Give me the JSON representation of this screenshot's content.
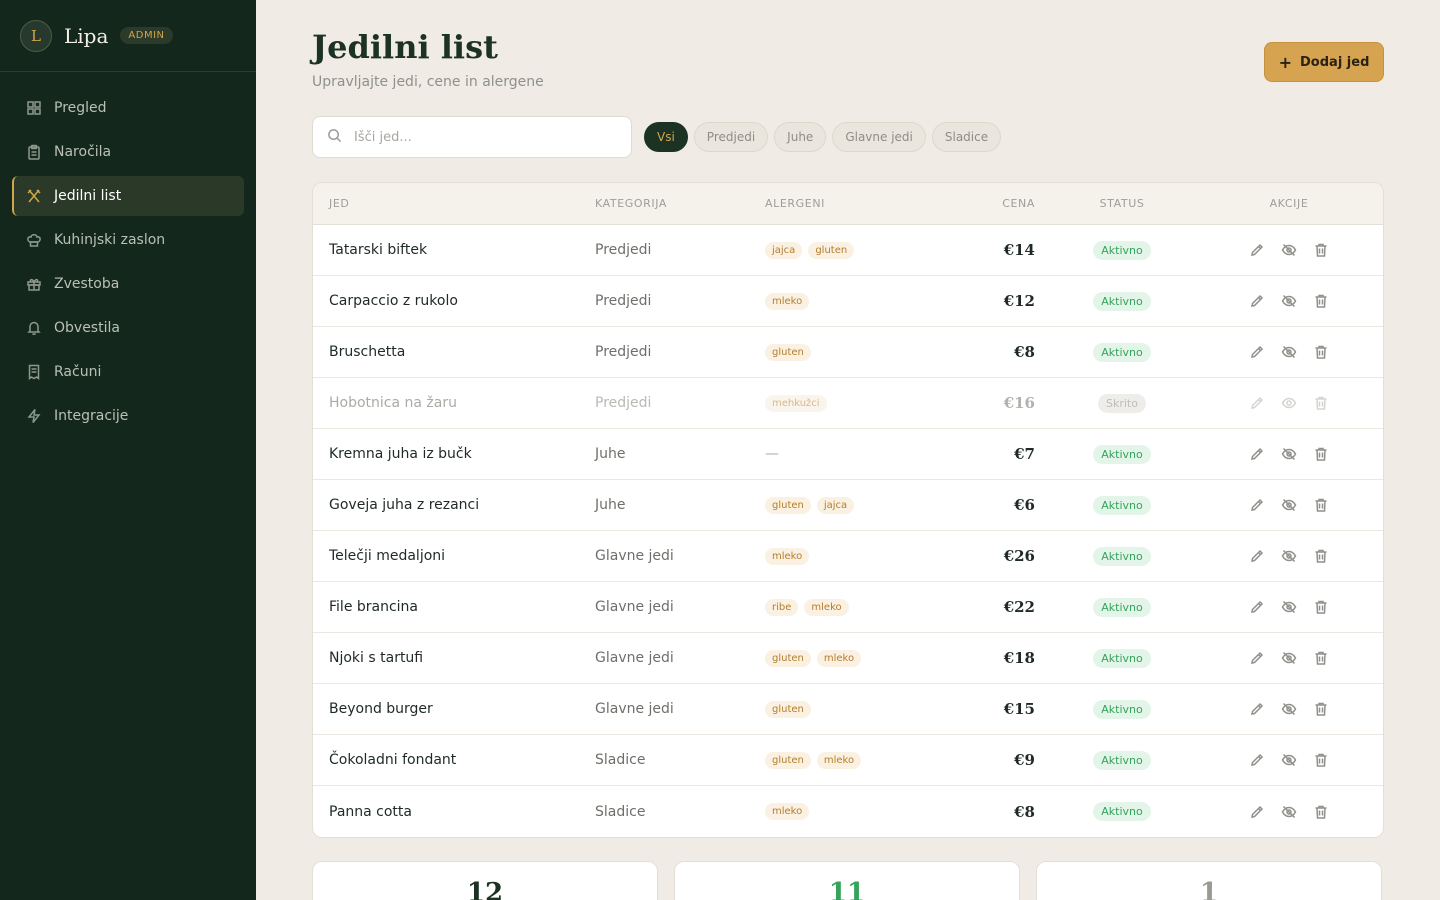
{
  "brand": {
    "logo_letter": "L",
    "name": "Lipa",
    "badge": "ADMIN"
  },
  "nav": [
    {
      "label": "Pregled",
      "icon": "grid-icon",
      "active": false
    },
    {
      "label": "Naročila",
      "icon": "clipboard-icon",
      "active": false
    },
    {
      "label": "Jedilni list",
      "icon": "utensils-icon",
      "active": true
    },
    {
      "label": "Kuhinjski zaslon",
      "icon": "chef-hat-icon",
      "active": false
    },
    {
      "label": "Zvestoba",
      "icon": "gift-icon",
      "active": false
    },
    {
      "label": "Obvestila",
      "icon": "bell-icon",
      "active": false
    },
    {
      "label": "Računi",
      "icon": "receipt-icon",
      "active": false
    },
    {
      "label": "Integracije",
      "icon": "bolt-icon",
      "active": false
    }
  ],
  "header": {
    "title": "Jedilni list",
    "subtitle": "Upravljajte jedi, cene in alergene",
    "add_label": "Dodaj jed"
  },
  "search": {
    "placeholder": "Išči jed..."
  },
  "filters": [
    {
      "label": "Vsi",
      "active": true
    },
    {
      "label": "Predjedi",
      "active": false
    },
    {
      "label": "Juhe",
      "active": false
    },
    {
      "label": "Glavne jedi",
      "active": false
    },
    {
      "label": "Sladice",
      "active": false
    }
  ],
  "table": {
    "columns": {
      "name": "JED",
      "category": "KATEGORIJA",
      "allergens": "ALERGENI",
      "price": "CENA",
      "status": "STATUS",
      "actions": "AKCIJE"
    },
    "rows": [
      {
        "name": "Tatarski biftek",
        "category": "Predjedi",
        "allergens": [
          "jajca",
          "gluten"
        ],
        "price": "€14",
        "status": "Aktivno",
        "hidden": false
      },
      {
        "name": "Carpaccio z rukolo",
        "category": "Predjedi",
        "allergens": [
          "mleko"
        ],
        "price": "€12",
        "status": "Aktivno",
        "hidden": false
      },
      {
        "name": "Bruschetta",
        "category": "Predjedi",
        "allergens": [
          "gluten"
        ],
        "price": "€8",
        "status": "Aktivno",
        "hidden": false
      },
      {
        "name": "Hobotnica na žaru",
        "category": "Predjedi",
        "allergens": [
          "mehkužci"
        ],
        "price": "€16",
        "status": "Skrito",
        "hidden": true
      },
      {
        "name": "Kremna juha iz bučk",
        "category": "Juhe",
        "allergens": [],
        "price": "€7",
        "status": "Aktivno",
        "hidden": false
      },
      {
        "name": "Goveja juha z rezanci",
        "category": "Juhe",
        "allergens": [
          "gluten",
          "jajca"
        ],
        "price": "€6",
        "status": "Aktivno",
        "hidden": false
      },
      {
        "name": "Telečji medaljoni",
        "category": "Glavne jedi",
        "allergens": [
          "mleko"
        ],
        "price": "€26",
        "status": "Aktivno",
        "hidden": false
      },
      {
        "name": "File brancina",
        "category": "Glavne jedi",
        "allergens": [
          "ribe",
          "mleko"
        ],
        "price": "€22",
        "status": "Aktivno",
        "hidden": false
      },
      {
        "name": "Njoki s tartufi",
        "category": "Glavne jedi",
        "allergens": [
          "gluten",
          "mleko"
        ],
        "price": "€18",
        "status": "Aktivno",
        "hidden": false
      },
      {
        "name": "Beyond burger",
        "category": "Glavne jedi",
        "allergens": [
          "gluten"
        ],
        "price": "€15",
        "status": "Aktivno",
        "hidden": false
      },
      {
        "name": "Čokoladni fondant",
        "category": "Sladice",
        "allergens": [
          "gluten",
          "mleko"
        ],
        "price": "€9",
        "status": "Aktivno",
        "hidden": false
      },
      {
        "name": "Panna cotta",
        "category": "Sladice",
        "allergens": [
          "mleko"
        ],
        "price": "€8",
        "status": "Aktivno",
        "hidden": false
      }
    ],
    "empty_allergen": "—"
  },
  "stats": [
    {
      "value": "12",
      "color": "#1c3324"
    },
    {
      "value": "11",
      "color": "#36a35d"
    },
    {
      "value": "1",
      "color": "#9a9a94"
    }
  ]
}
